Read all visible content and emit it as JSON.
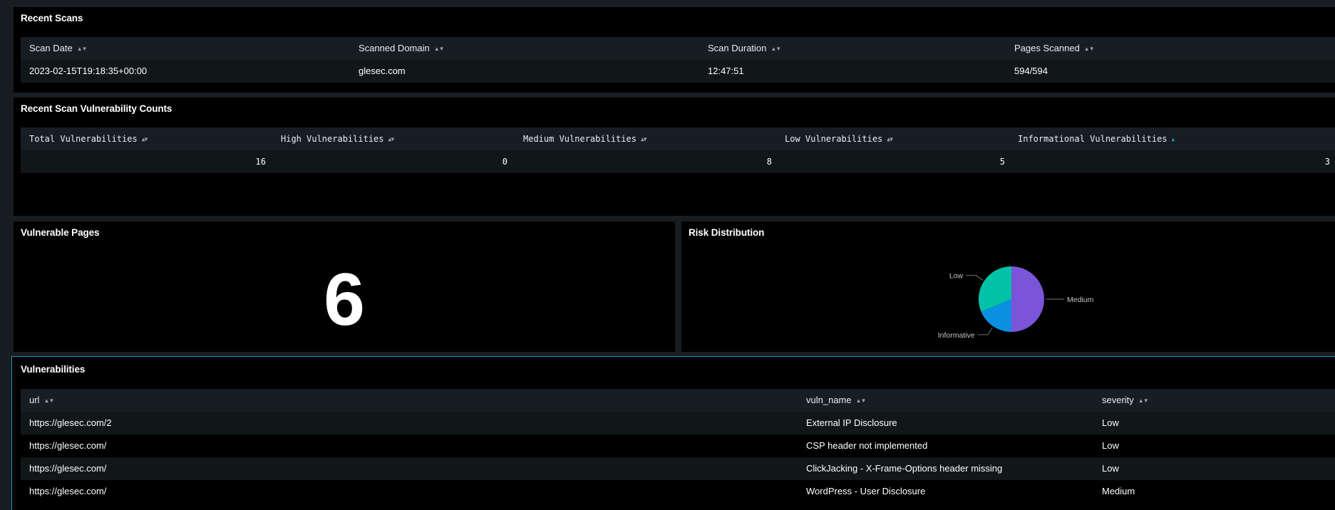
{
  "recent_scans": {
    "title": "Recent Scans",
    "columns": [
      "Scan Date",
      "Scanned Domain",
      "Scan Duration",
      "Pages Scanned"
    ],
    "rows": [
      [
        "2023-02-15T19:18:35+00:00",
        "glesec.com",
        "12:47:51",
        "594/594"
      ]
    ]
  },
  "vuln_counts": {
    "title": "Recent Scan Vulnerability Counts",
    "columns": [
      "Total Vulnerabilities",
      "High Vulnerabilities",
      "Medium Vulnerabilities",
      "Low Vulnerabilities",
      "Informational Vulnerabilities"
    ],
    "sorted_column_index": 4,
    "rows": [
      [
        "16",
        "0",
        "8",
        "5",
        "3"
      ]
    ]
  },
  "vulnerable_pages": {
    "title": "Vulnerable Pages",
    "value": "6"
  },
  "risk_distribution": {
    "title": "Risk Distribution",
    "chart_data": {
      "type": "pie",
      "categories": [
        "Medium",
        "Informative",
        "Low"
      ],
      "values": [
        8,
        3,
        5
      ],
      "colors": [
        "#7b55d9",
        "#0b8fe0",
        "#00c2a8"
      ]
    }
  },
  "vulnerabilities": {
    "title": "Vulnerabilities",
    "columns": [
      "url",
      "vuln_name",
      "severity"
    ],
    "rows": [
      [
        "https://glesec.com/2",
        "External IP Disclosure",
        "Low"
      ],
      [
        "https://glesec.com/",
        "CSP header not implemented",
        "Low"
      ],
      [
        "https://glesec.com/",
        "ClickJacking - X-Frame-Options header missing",
        "Low"
      ],
      [
        "https://glesec.com/",
        "WordPress - User Disclosure",
        "Medium"
      ]
    ]
  },
  "icons": {
    "sort": "sort-arrows-icon",
    "sort_asc": "sort-ascending-icon"
  },
  "colors": {
    "background": "#171d21",
    "panel": "#000000",
    "accent": "#1e93c6"
  }
}
